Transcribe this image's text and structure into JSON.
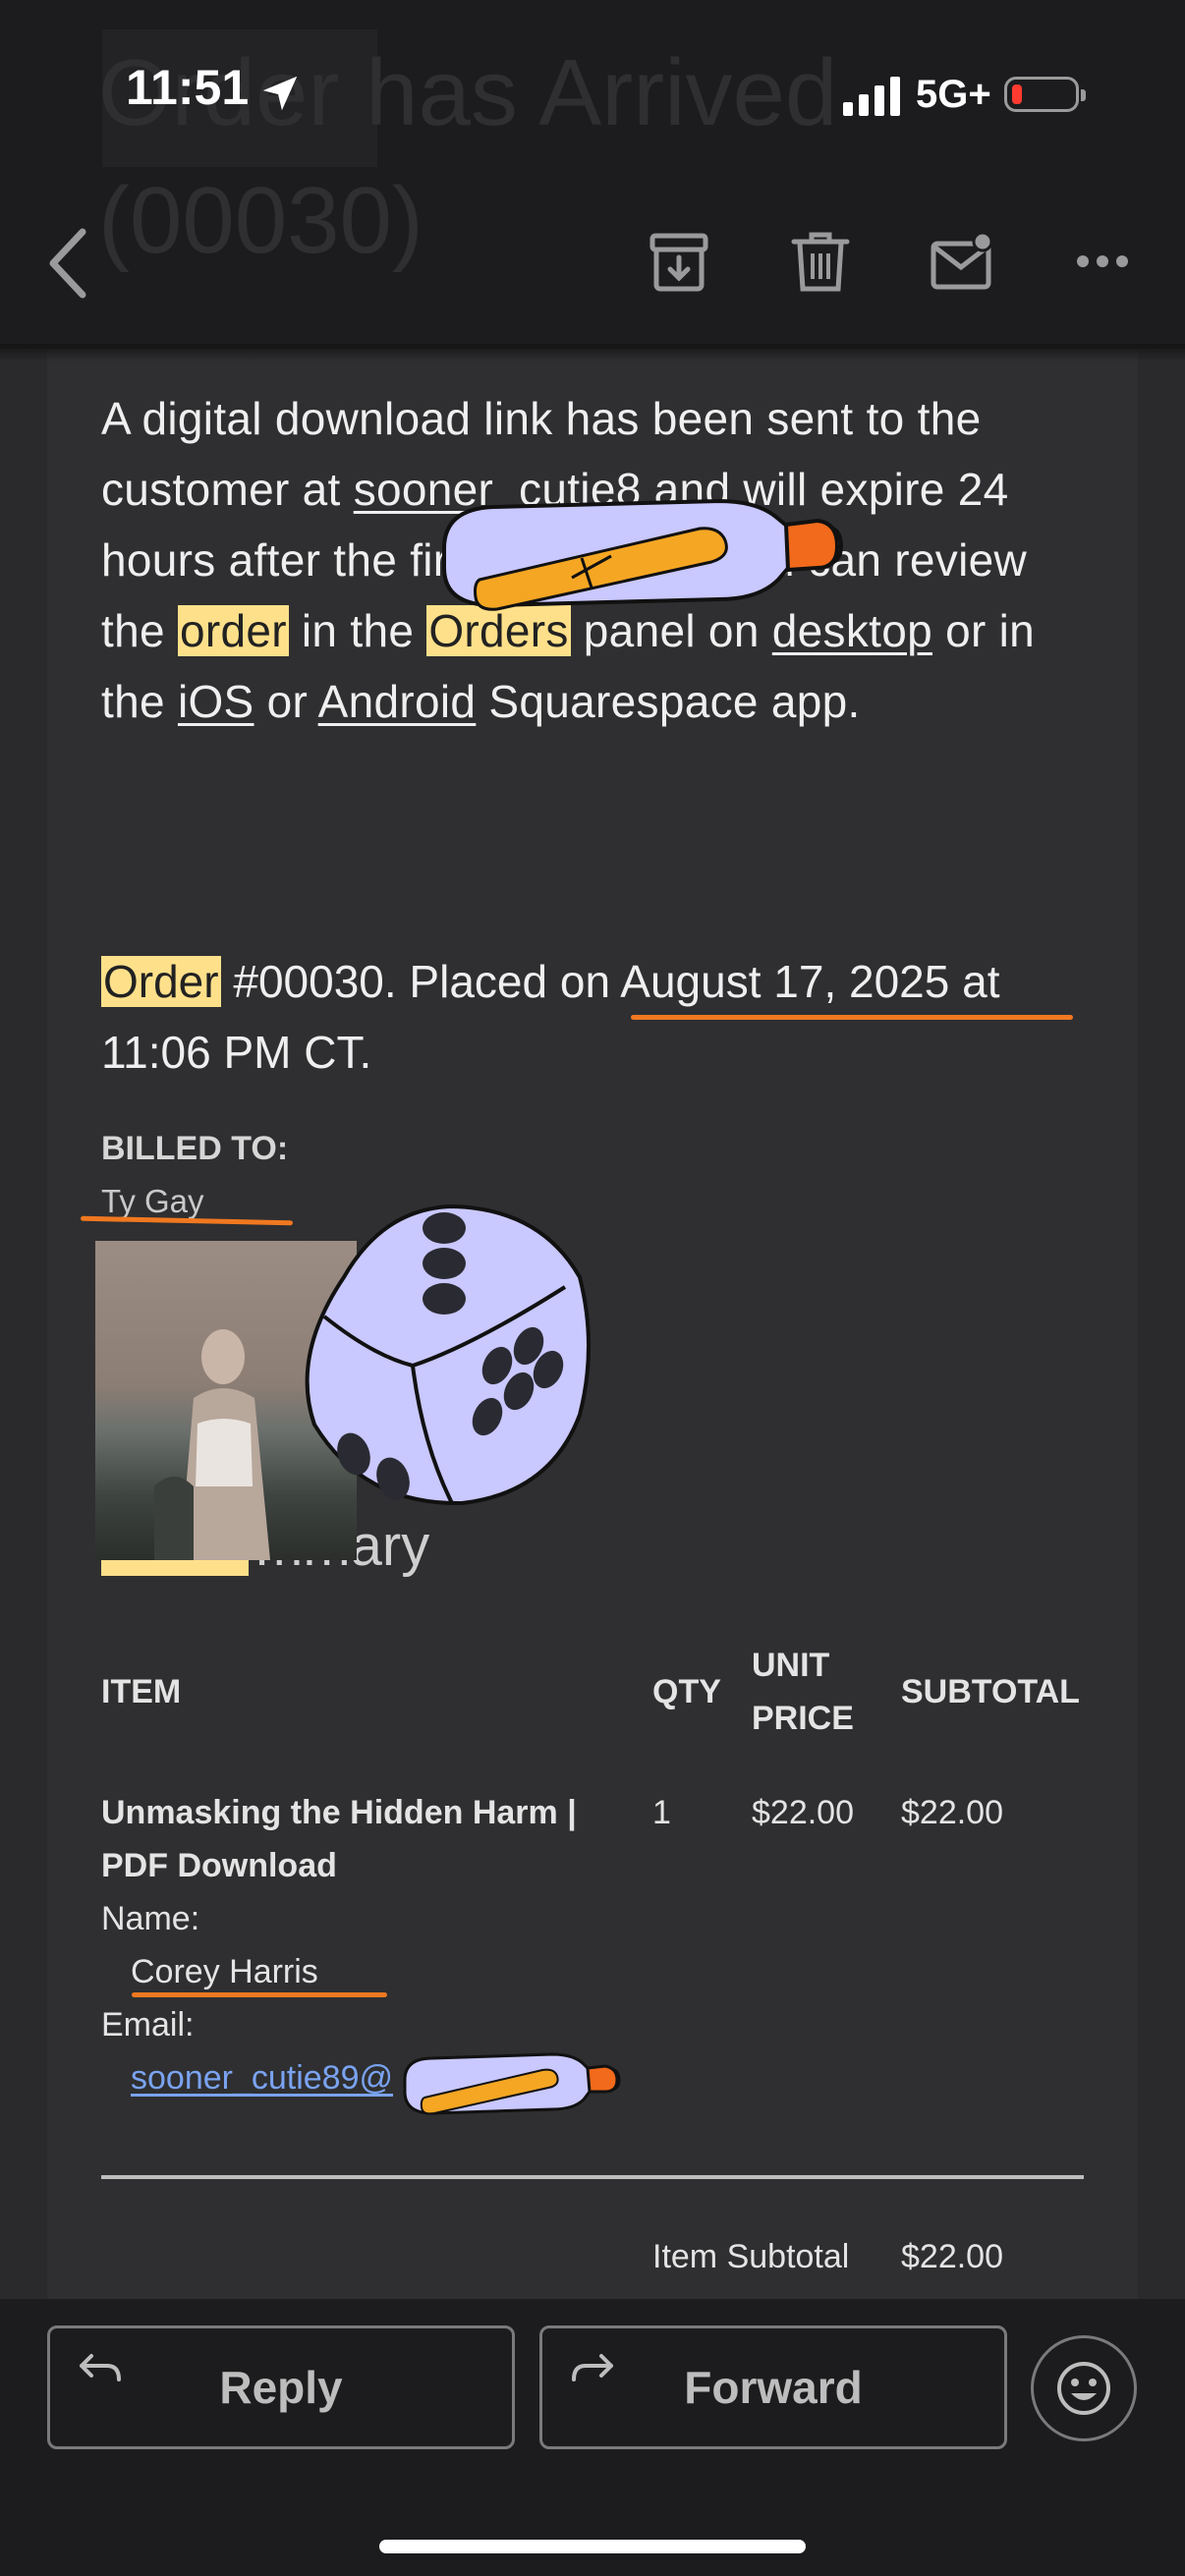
{
  "status_bar": {
    "time": "11:51",
    "network": "5G+",
    "battery_level": 0.1
  },
  "header": {
    "ghost_subject": "Order has Arrived\n(00030)",
    "icons": [
      "back-chevron-icon",
      "archive-icon",
      "trash-icon",
      "mark-unread-icon",
      "more-icon"
    ]
  },
  "email": {
    "paragraph": {
      "p1": "A digital download link has been sent to the customer at ",
      "email_link": "sooner_cutie8",
      "p2": " and will expire 24 hours after the first download. You can review the ",
      "hl_order": "order",
      "p3": " in the ",
      "hl_orders": "Orders",
      "p4": " panel on ",
      "link_desktop": "desktop",
      "p5": " or in the ",
      "link_ios": "iOS",
      "p6": " or ",
      "link_android": "Android",
      "p7": " Squarespace app."
    },
    "order_line": {
      "hl_order": "Order",
      "text1": " #00030. Placed on ",
      "date": "August 17, 2025",
      "text2": " at 11:06 PM CT."
    },
    "billed_to_label": "BILLED TO:",
    "billed_to_name": "Ty Gay",
    "summary_title": "mmary",
    "table": {
      "headers": {
        "item": "ITEM",
        "qty": "QTY",
        "unit_price_1": "UNIT",
        "unit_price_2": "PRICE",
        "subtotal": "SUBTOTAL"
      },
      "row": {
        "item_name_1": "Unmasking the Hidden Harm |",
        "item_name_2": "PDF Download",
        "name_label": "Name:",
        "name_value": "Corey Harris",
        "email_label": "Email:",
        "email_value": "sooner_cutie89@",
        "qty": "1",
        "unit_price": "$22.00",
        "subtotal": "$22.00"
      },
      "item_subtotal_label": "Item Subtotal",
      "item_subtotal_value": "$22.00"
    }
  },
  "actions": {
    "reply": "Reply",
    "forward": "Forward"
  },
  "colors": {
    "highlight": "#ffe08a",
    "annotation_orange": "#f07820",
    "sticker_lavender": "#c9c8ff",
    "link_blue": "#7aa3f0"
  }
}
